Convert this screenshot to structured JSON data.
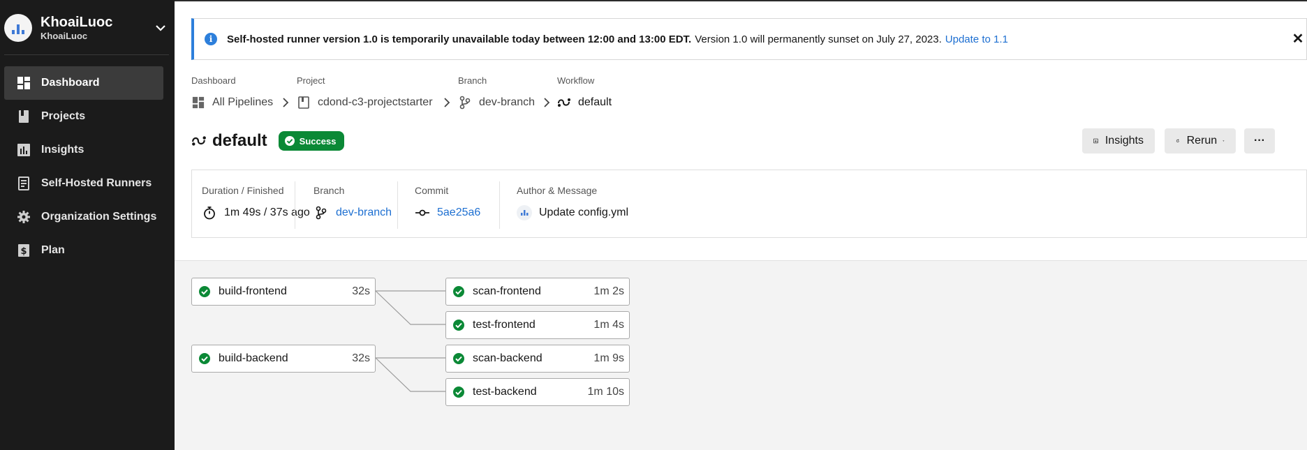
{
  "org": {
    "name": "KhoaiLuoc",
    "sub": "KhoaiLuoc"
  },
  "sidebar": {
    "items": [
      {
        "label": "Dashboard",
        "icon": "dashboard-icon",
        "active": true
      },
      {
        "label": "Projects",
        "icon": "book-icon"
      },
      {
        "label": "Insights",
        "icon": "chart-icon"
      },
      {
        "label": "Self-Hosted Runners",
        "icon": "runner-icon"
      },
      {
        "label": "Organization Settings",
        "icon": "gear-icon"
      },
      {
        "label": "Plan",
        "icon": "dollar-icon"
      }
    ]
  },
  "banner": {
    "strong": "Self-hosted runner version 1.0 is temporarily unavailable today between 12:00 and 13:00 EDT.",
    "text": "Version 1.0 will permanently sunset on July 27, 2023.",
    "link": "Update to 1.1",
    "close": "✕"
  },
  "breadcrumbs": {
    "dashboard": {
      "label": "Dashboard",
      "value": "All Pipelines"
    },
    "project": {
      "label": "Project",
      "value": "cdond-c3-projectstarter"
    },
    "branch": {
      "label": "Branch",
      "value": "dev-branch"
    },
    "workflow": {
      "label": "Workflow",
      "value": "default"
    }
  },
  "workflow": {
    "name": "default",
    "status": "Success"
  },
  "actions": {
    "insights": "Insights",
    "rerun": "Rerun",
    "more": "···"
  },
  "meta": {
    "duration": {
      "label": "Duration / Finished",
      "value": "1m 49s / 37s ago"
    },
    "branch": {
      "label": "Branch",
      "value": "dev-branch"
    },
    "commit": {
      "label": "Commit",
      "value": "5ae25a6"
    },
    "author": {
      "label": "Author & Message",
      "value": "Update config.yml"
    }
  },
  "jobs": {
    "build_frontend": {
      "name": "build-frontend",
      "duration": "32s"
    },
    "scan_frontend": {
      "name": "scan-frontend",
      "duration": "1m 2s"
    },
    "test_frontend": {
      "name": "test-frontend",
      "duration": "1m 4s"
    },
    "build_backend": {
      "name": "build-backend",
      "duration": "32s"
    },
    "scan_backend": {
      "name": "scan-backend",
      "duration": "1m 9s"
    },
    "test_backend": {
      "name": "test-backend",
      "duration": "1m 10s"
    }
  },
  "colors": {
    "success": "#0b8936",
    "link": "#1d6fd1",
    "sidebar": "#1b1b1b",
    "accent": "#2d7fdb"
  }
}
